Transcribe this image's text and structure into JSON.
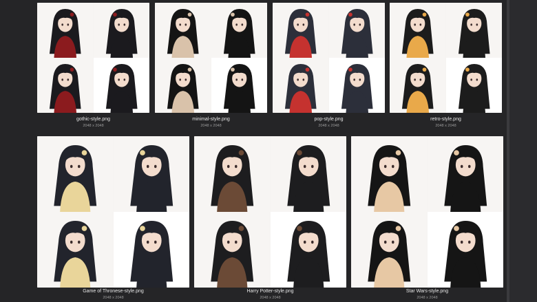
{
  "gallery": {
    "items": [
      {
        "filename": "gothic-style.png",
        "dimensions": "2048 x 2048",
        "palette": [
          "#1b1a1e",
          "#e9e6e4",
          "#8b1b1e"
        ]
      },
      {
        "filename": "minimal-style.png",
        "dimensions": "2048 x 2048",
        "palette": [
          "#141414",
          "#f2ede6",
          "#d9c2aa"
        ]
      },
      {
        "filename": "pop-style.png",
        "dimensions": "2048 x 2048",
        "palette": [
          "#2c2f3a",
          "#c9dff0",
          "#c5322f"
        ]
      },
      {
        "filename": "retro-style.png",
        "dimensions": "2048 x 2048",
        "palette": [
          "#1c1c1c",
          "#d33c3c",
          "#e9a94a"
        ]
      },
      {
        "filename": "Game of Thronese-style.png",
        "dimensions": "2048 x 2048",
        "palette": [
          "#22242c",
          "#c8d5e3",
          "#e9d59a"
        ]
      },
      {
        "filename": "Harry Potter-style.png",
        "dimensions": "2048 x 2048",
        "palette": [
          "#1d1d1f",
          "#d9d4cf",
          "#6b4a36"
        ]
      },
      {
        "filename": "Star Wars-style.png",
        "dimensions": "2048 x 2048",
        "palette": [
          "#151515",
          "#b8262a",
          "#e7c8a4"
        ]
      }
    ]
  }
}
